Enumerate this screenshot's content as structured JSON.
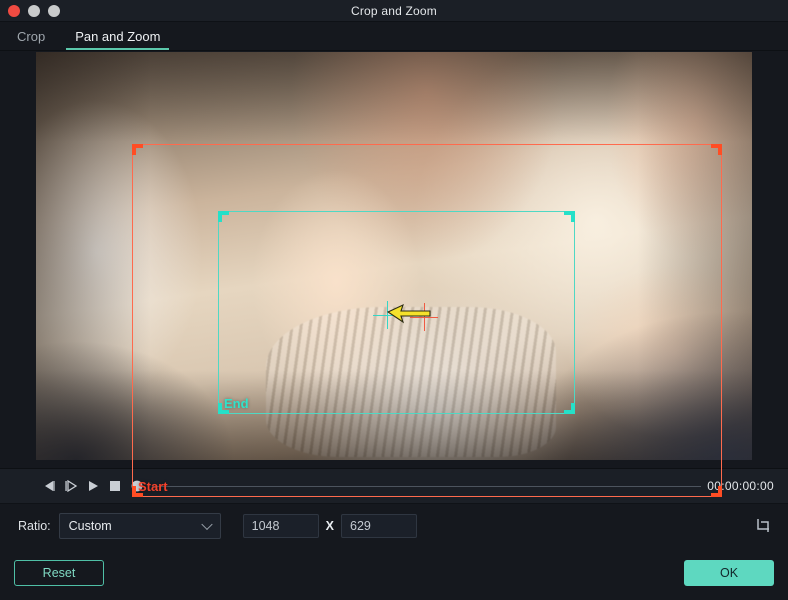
{
  "window": {
    "title": "Crop and Zoom",
    "controls": {
      "close": "close-button",
      "minimize": "minimize-button",
      "maximize": "maximize-button"
    }
  },
  "tabs": [
    {
      "label": "Crop",
      "active": false
    },
    {
      "label": "Pan and Zoom",
      "active": true
    }
  ],
  "preview": {
    "start_rect_label": "Start",
    "end_rect_label": "End",
    "start_color": "#ff6a4d",
    "end_color": "#4fd8c4"
  },
  "transport": {
    "prev_frame": "previous-frame",
    "next_frame": "next-frame",
    "play": "play",
    "stop": "stop",
    "marker": "keyframe-marker",
    "timecode": "00:00:00:00"
  },
  "ratio": {
    "label": "Ratio:",
    "selected": "Custom",
    "options": [
      "Custom"
    ],
    "width": "1048",
    "separator": "X",
    "height": "629",
    "crop_tool": "crop-rotate-icon"
  },
  "footer": {
    "reset_label": "Reset",
    "ok_label": "OK",
    "accent": "#5ed8c0"
  }
}
